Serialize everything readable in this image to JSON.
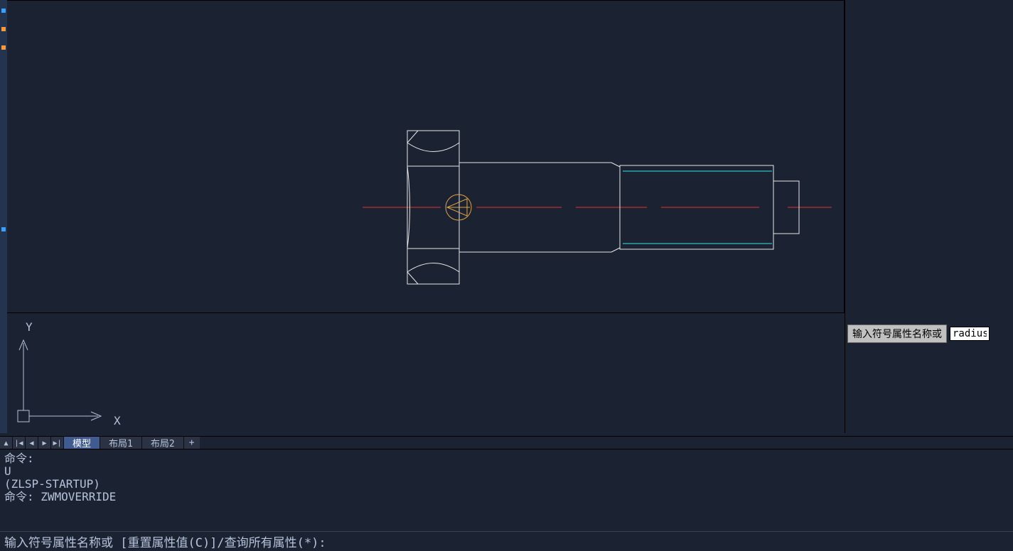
{
  "ucs": {
    "x_label": "X",
    "y_label": "Y"
  },
  "tabs": {
    "model": "模型",
    "layout1": "布局1",
    "layout2": "布局2",
    "add": "+"
  },
  "cmd_history": {
    "l1": "命令:",
    "l2": "U",
    "l3": "(ZLSP-STARTUP)",
    "l4": "命令: ZWMOVERRIDE"
  },
  "cmd_line": {
    "prompt": "输入符号属性名称或 [重置属性值(C)]/查询所有属性(*):"
  },
  "tooltip": {
    "label": "输入符号属性名称或"
  },
  "float_input": {
    "value": "radius"
  },
  "nav": {
    "up": "▲",
    "first": "|◀",
    "prev": "◀",
    "next": "▶",
    "last": "▶|"
  }
}
